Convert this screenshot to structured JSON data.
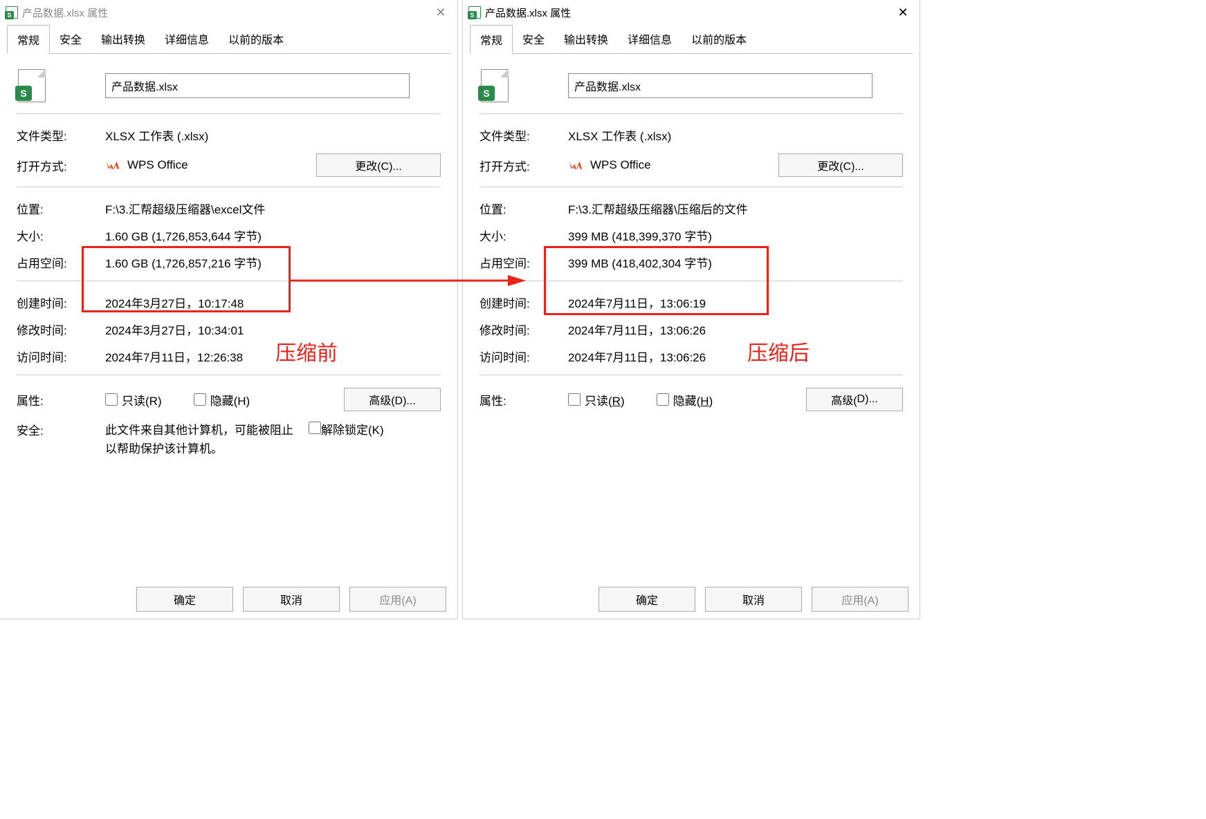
{
  "annotations": {
    "beforeLabel": "压缩前",
    "afterLabel": "压缩后"
  },
  "tabs": [
    "常规",
    "安全",
    "输出转换",
    "详细信息",
    "以前的版本"
  ],
  "labels": {
    "fileType": "文件类型:",
    "openWith": "打开方式:",
    "location": "位置:",
    "size": "大小:",
    "sizeOnDisk": "占用空间:",
    "created": "创建时间:",
    "modified": "修改时间:",
    "accessed": "访问时间:",
    "attributes": "属性:",
    "security": "安全:",
    "readonly": "只读(R)",
    "hidden": "隐藏(H)",
    "readonlyU": "只读(",
    "readonlyU2": ")",
    "hiddenU": "隐藏(",
    "hiddenU2": ")",
    "unblock": "解除锁定(K)",
    "changeBtn": "更改(C)...",
    "advancedBtn": "高级(D)...",
    "ok": "确定",
    "cancel": "取消",
    "apply": "应用(A)"
  },
  "left": {
    "title": "产品数据.xlsx 属性",
    "filename": "产品数据.xlsx",
    "fileType": "XLSX 工作表 (.xlsx)",
    "openWith": "WPS Office",
    "location": "F:\\3.汇帮超级压缩器\\excel文件",
    "size": "1.60 GB (1,726,853,644 字节)",
    "sizeOnDisk": "1.60 GB (1,726,857,216 字节)",
    "created": "2024年3月27日，10:17:48",
    "modified": "2024年3月27日，10:34:01",
    "accessed": "2024年7月11日，12:26:38",
    "securityText": "此文件来自其他计算机，可能被阻止以帮助保护该计算机。"
  },
  "right": {
    "title": "产品数据.xlsx 属性",
    "filename": "产品数据.xlsx",
    "fileType": "XLSX 工作表 (.xlsx)",
    "openWith": "WPS Office",
    "location": "F:\\3.汇帮超级压缩器\\压缩后的文件",
    "size": "399 MB (418,399,370 字节)",
    "sizeOnDisk": "399 MB (418,402,304 字节)",
    "created": "2024年7月11日，13:06:19",
    "modified": "2024年7月11日，13:06:26",
    "accessed": "2024年7月11日，13:06:26"
  }
}
